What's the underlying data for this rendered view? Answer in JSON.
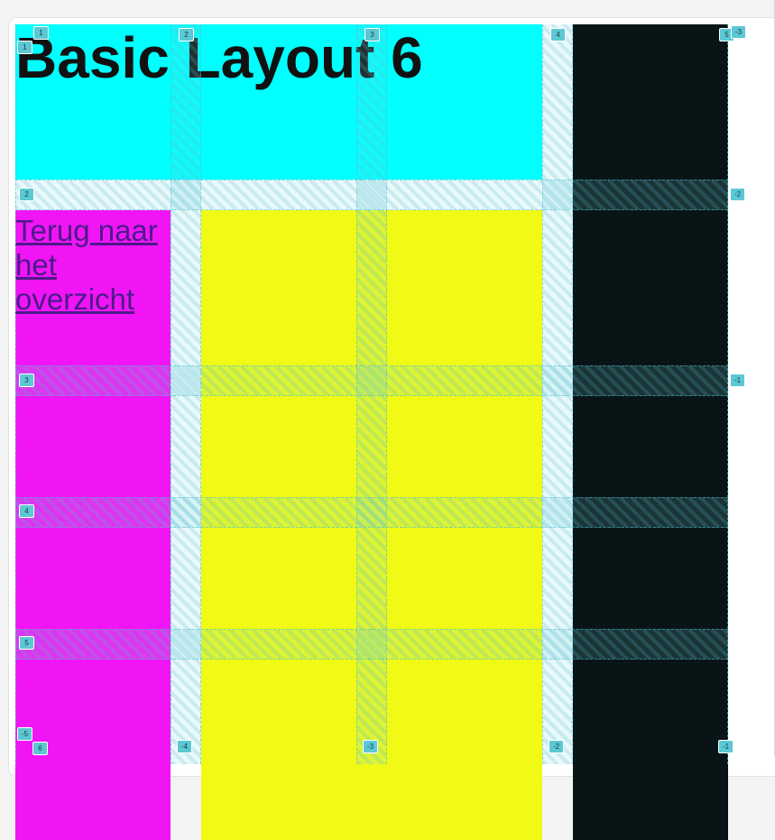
{
  "page": {
    "title": "Basic Layout 6",
    "back_link": "Terug naar het overzicht"
  },
  "colors": {
    "header": "#00ffff",
    "sidebar": "#091416",
    "nav": "#f115f5",
    "main": "#f0fa14",
    "grid_overlay": "#5bc8d4"
  },
  "grid_lines": {
    "top": [
      "1",
      "2",
      "3",
      "4",
      "5"
    ],
    "top_right": "-3",
    "left": [
      "1",
      "2",
      "3",
      "4",
      "5"
    ],
    "left_bottom_neg": "-5",
    "left_bottom": "6",
    "right": [
      "-2",
      "-1"
    ],
    "bottom": [
      "-4",
      "-3",
      "-2",
      "-1"
    ]
  }
}
